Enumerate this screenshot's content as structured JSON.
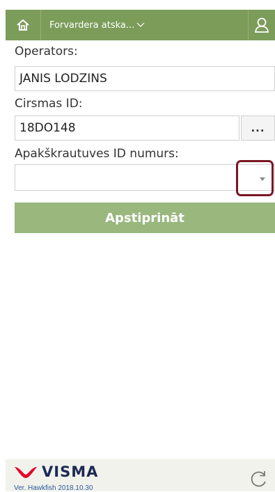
{
  "header": {
    "title": "Forvardera atska...",
    "home_icon": "home-icon",
    "user_icon": "user-icon",
    "accent": "#7c9c5a"
  },
  "form": {
    "operator_label": "Operators:",
    "operator_value": "JANIS LODZINS",
    "cirsmas_label": "Cirsmas ID:",
    "cirsmas_value": "18DO148",
    "browse_label": "...",
    "subdepot_label": "Apakškrautuves ID numurs:",
    "subdepot_value": "",
    "confirm_label": "Apstiprināt"
  },
  "footer": {
    "logo_text": "VISMA",
    "version": "Ver. Hawkfish 2018.10.30",
    "refresh_icon": "refresh-icon"
  }
}
